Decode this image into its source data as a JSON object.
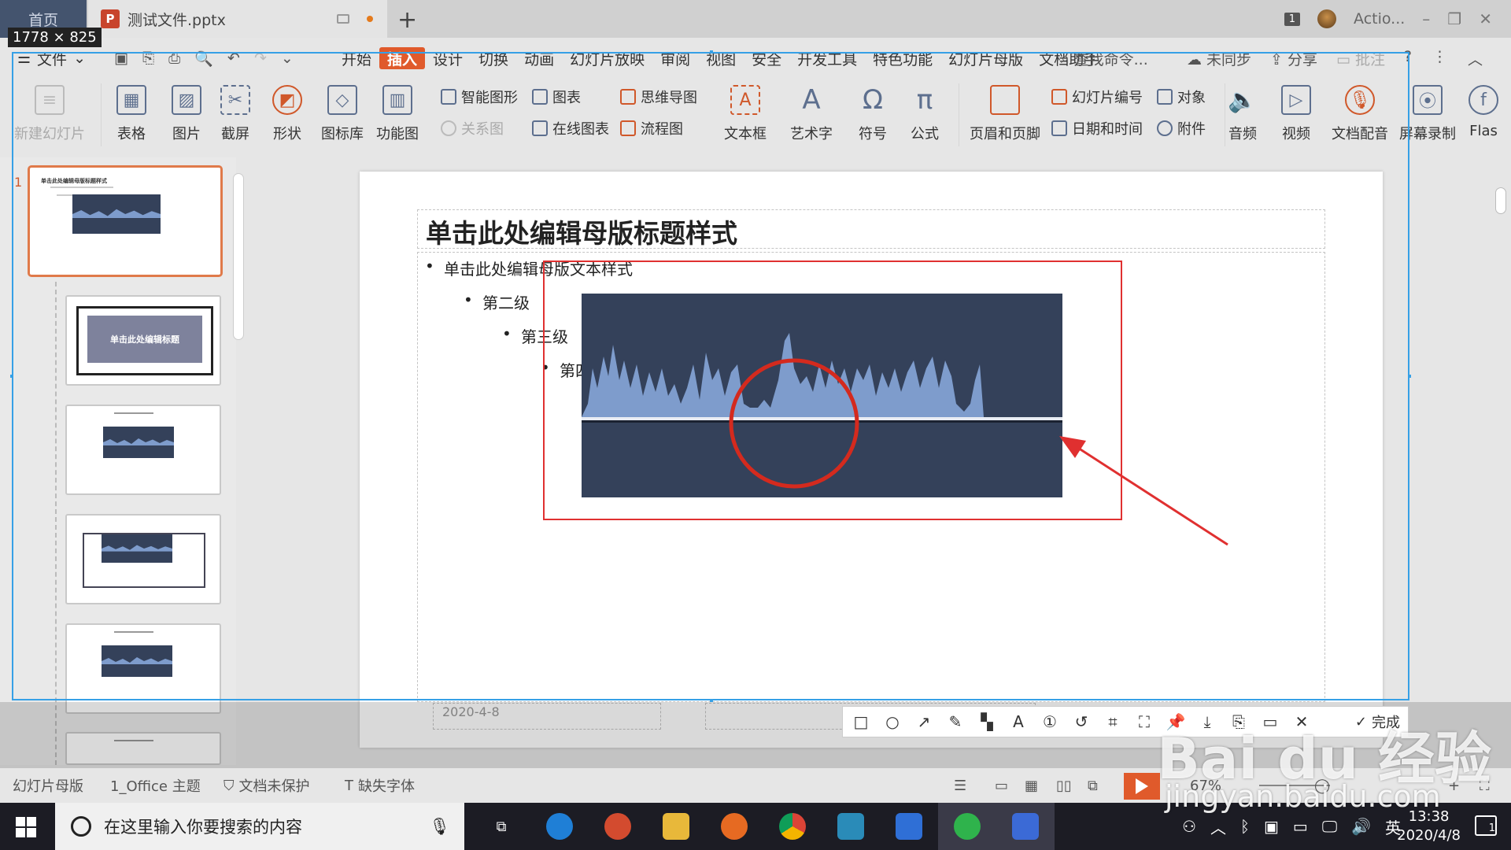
{
  "tabs": {
    "home": "首页",
    "doc": "测试文件.pptx"
  },
  "titlebar": {
    "badge": "1",
    "user": "Actio..."
  },
  "selection_size": "1778 × 825",
  "menu": {
    "file": "文件",
    "items": [
      "开始",
      "插入",
      "设计",
      "切换",
      "动画",
      "幻灯片放映",
      "审阅",
      "视图",
      "安全",
      "开发工具",
      "特色功能",
      "幻灯片母版",
      "文档助手"
    ],
    "active_index": 1,
    "search": "查找命令...",
    "sync": "未同步",
    "share": "分享",
    "comment": "批注"
  },
  "ribbon": {
    "new_slide": "新建幻灯片",
    "table": "表格",
    "picture": "图片",
    "screenshot": "截屏",
    "shape": "形状",
    "icon_lib": "图标库",
    "func_chart": "功能图",
    "smart_art": "智能图形",
    "chart": "图表",
    "mind_map": "思维导图",
    "relation": "关系图",
    "online_chart": "在线图表",
    "flowchart": "流程图",
    "textbox": "文本框",
    "art_text": "艺术字",
    "symbol": "符号",
    "formula": "公式",
    "header_footer": "页眉和页脚",
    "slide_number": "幻灯片编号",
    "object": "对象",
    "datetime": "日期和时间",
    "attachment": "附件",
    "audio": "音频",
    "video": "视频",
    "doc_voice": "文档配音",
    "screen_record": "屏幕录制",
    "flash": "Flas"
  },
  "thumbs": {
    "first_num": "1",
    "title_thumb": "单击此处编辑标题",
    "first_title": "单击此处编辑母版标题样式"
  },
  "slide": {
    "title": "单击此处编辑母版标题样式",
    "level1": "单击此处编辑母版文本样式",
    "level2": "第二级",
    "level3": "第三级",
    "level4": "第四",
    "footer_date": "2020-4-8"
  },
  "annotation": {
    "done": "完成"
  },
  "status": {
    "master": "幻灯片母版",
    "theme": "1_Office 主题",
    "protect": "文档未保护",
    "font": "缺失字体",
    "zoom": "67%"
  },
  "taskbar": {
    "search": "在这里输入你要搜索的内容",
    "ime": "英",
    "time": "13:38",
    "date": "2020/4/8",
    "notif": "1"
  },
  "watermark": {
    "main": "Bai du 经验",
    "sub": "jingyan.baidu.com"
  },
  "colors": {
    "accent": "#e05a2b",
    "wave_bg": "#34415a",
    "wave_fill": "#7e9ccc",
    "annotation": "#e03030",
    "selection": "#36a0e6"
  }
}
